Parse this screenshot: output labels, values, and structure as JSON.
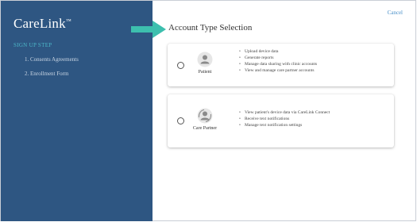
{
  "app": {
    "brand": "CareLink",
    "trademark": "™"
  },
  "sidebar": {
    "section_title": "SIGN UP STEP",
    "steps": [
      {
        "label": "1. Consents Agreements"
      },
      {
        "label": "2. Enrollment Form"
      }
    ]
  },
  "header": {
    "cancel_label": "Cancel",
    "title": "Account Type Selection"
  },
  "accounts": [
    {
      "role": "Patient",
      "icon": "person-icon",
      "features": [
        "Upload device data",
        "Generate reports",
        "Manage data sharing with clinic accounts",
        "View and manage care partner accounts"
      ]
    },
    {
      "role": "Care Partner",
      "icon": "person-care-icon",
      "features": [
        "View patient's device data via CareLink Connect",
        "Receive text notifications",
        "Manage text notification settings"
      ]
    }
  ],
  "colors": {
    "sidebar_bg": "#2e5682",
    "accent_teal": "#3dbfae",
    "step_head": "#4db8c9",
    "link": "#4a90c9"
  }
}
